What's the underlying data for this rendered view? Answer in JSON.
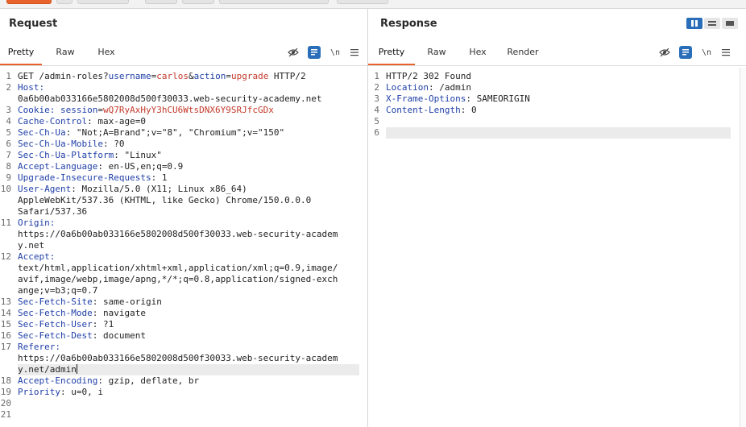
{
  "request": {
    "title": "Request",
    "tabs": [
      "Pretty",
      "Raw",
      "Hex"
    ],
    "active_tab": "Pretty",
    "tools": {
      "newline_label": "\\n"
    },
    "lines": [
      {
        "n": "1",
        "segments": [
          [
            "GET /admin-roles?",
            ""
          ],
          [
            "username",
            "param"
          ],
          [
            "=",
            ""
          ],
          [
            "carlos",
            "pval"
          ],
          [
            "&",
            ""
          ],
          [
            "action",
            "param"
          ],
          [
            "=",
            ""
          ],
          [
            "upgrade",
            "pval"
          ],
          [
            " HTTP/2",
            ""
          ]
        ]
      },
      {
        "n": "2",
        "segments": [
          [
            "Host:",
            "hk"
          ]
        ]
      },
      {
        "n": "",
        "segments": [
          [
            "0a6b00ab033166e5802008d500f30033.web-security-academy.net",
            ""
          ]
        ]
      },
      {
        "n": "3",
        "segments": [
          [
            "Cookie: ",
            "hk"
          ],
          [
            "session",
            "param"
          ],
          [
            "=",
            ""
          ],
          [
            "wQ7RyAxHyY3hCU6WtsDNX6Y9SRJfcGDx",
            "cval"
          ]
        ]
      },
      {
        "n": "4",
        "segments": [
          [
            "Cache-Control",
            ""
          ],
          [
            ": max-age=0",
            ""
          ]
        ]
      },
      {
        "n": "5",
        "segments": [
          [
            "Sec-Ch-Ua",
            ""
          ],
          [
            ": \"Not;A=Brand\";v=\"8\", \"Chromium\";v=\"150\"",
            ""
          ]
        ]
      },
      {
        "n": "6",
        "segments": [
          [
            "Sec-Ch-Ua-Mobile",
            ""
          ],
          [
            ": ?0",
            ""
          ]
        ]
      },
      {
        "n": "7",
        "segments": [
          [
            "Sec-Ch-Ua-Platform",
            ""
          ],
          [
            ": \"Linux\"",
            ""
          ]
        ]
      },
      {
        "n": "8",
        "segments": [
          [
            "Accept-Language",
            ""
          ],
          [
            ": en-US,en;q=0.9",
            ""
          ]
        ]
      },
      {
        "n": "9",
        "segments": [
          [
            "Upgrade-Insecure-Requests",
            ""
          ],
          [
            ": 1",
            ""
          ]
        ]
      },
      {
        "n": "10",
        "segments": [
          [
            "User-Agent",
            ""
          ],
          [
            ": Mozilla/5.0 (X11; Linux x86_64)",
            ""
          ]
        ]
      },
      {
        "n": "",
        "segments": [
          [
            "AppleWebKit/537.36 (KHTML, like Gecko) Chrome/150.0.0.0",
            ""
          ]
        ]
      },
      {
        "n": "",
        "segments": [
          [
            "Safari/537.36",
            ""
          ]
        ]
      },
      {
        "n": "11",
        "segments": [
          [
            "Origin:",
            ""
          ]
        ]
      },
      {
        "n": "",
        "segments": [
          [
            "https://0a6b00ab033166e5802008d500f30033.web-security-academ",
            ""
          ]
        ]
      },
      {
        "n": "",
        "segments": [
          [
            "y.net",
            ""
          ]
        ]
      },
      {
        "n": "12",
        "segments": [
          [
            "Accept:",
            ""
          ]
        ]
      },
      {
        "n": "",
        "segments": [
          [
            "text/html,application/xhtml+xml,application/xml;q=0.9,image/",
            ""
          ]
        ]
      },
      {
        "n": "",
        "segments": [
          [
            "avif,image/webp,image/apng,*/*;q=0.8,application/signed-exch",
            ""
          ]
        ]
      },
      {
        "n": "",
        "segments": [
          [
            "ange;v=b3;q=0.7",
            ""
          ]
        ]
      },
      {
        "n": "13",
        "segments": [
          [
            "Sec-Fetch-Site",
            ""
          ],
          [
            ": same-origin",
            ""
          ]
        ]
      },
      {
        "n": "14",
        "segments": [
          [
            "Sec-Fetch-Mode",
            ""
          ],
          [
            ": navigate",
            ""
          ]
        ]
      },
      {
        "n": "15",
        "segments": [
          [
            "Sec-Fetch-User",
            ""
          ],
          [
            ": ?1",
            ""
          ]
        ]
      },
      {
        "n": "16",
        "segments": [
          [
            "Sec-Fetch-Dest",
            ""
          ],
          [
            ": document",
            ""
          ]
        ]
      },
      {
        "n": "17",
        "segments": [
          [
            "Referer:",
            ""
          ]
        ]
      },
      {
        "n": "",
        "segments": [
          [
            "https://0a6b00ab033166e5802008d500f30033.web-security-academ",
            ""
          ]
        ]
      },
      {
        "n": "",
        "segments": [
          [
            "y.net/admin",
            ""
          ]
        ],
        "caret": true
      },
      {
        "n": "18",
        "segments": [
          [
            "Accept-Encoding",
            ""
          ],
          [
            ": gzip, deflate, br",
            ""
          ]
        ]
      },
      {
        "n": "19",
        "segments": [
          [
            "Priority",
            ""
          ],
          [
            ": u=0, i",
            ""
          ]
        ]
      },
      {
        "n": "20",
        "segments": []
      },
      {
        "n": "21",
        "segments": []
      }
    ]
  },
  "response": {
    "title": "Response",
    "tabs": [
      "Pretty",
      "Raw",
      "Hex",
      "Render"
    ],
    "active_tab": "Pretty",
    "tools": {
      "newline_label": "\\n"
    },
    "lines": [
      {
        "n": "1",
        "segments": [
          [
            "HTTP/2 302 Found",
            ""
          ]
        ]
      },
      {
        "n": "2",
        "segments": [
          [
            "Location",
            ""
          ],
          [
            ": /admin",
            ""
          ]
        ]
      },
      {
        "n": "3",
        "segments": [
          [
            "X-Frame-Options",
            ""
          ],
          [
            ": SAMEORIGIN",
            ""
          ]
        ]
      },
      {
        "n": "4",
        "segments": [
          [
            "Content-Length",
            ""
          ],
          [
            ": 0",
            ""
          ]
        ]
      },
      {
        "n": "5",
        "segments": []
      },
      {
        "n": "6",
        "segments": []
      }
    ]
  },
  "colors": {
    "accent": "#e8642c",
    "header_key": "#1f3fa8",
    "param_value": "#c33a2b",
    "tool_blue": "#2a6db8"
  }
}
